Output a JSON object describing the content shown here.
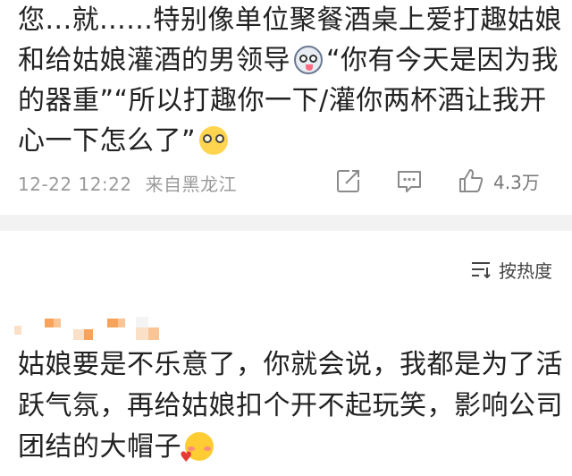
{
  "post": {
    "text_lines": [
      "您...就......特别像单位聚餐酒桌上爱打趣姑娘",
      "和给姑娘灌酒的男领导",
      "“你有今天是因为我",
      "的器重”“所以打趣你一下/灌你两杯酒让我开",
      "心一下怎么了”"
    ],
    "emoji_1": "doge-emoji",
    "emoji_2": "glasses-emoji",
    "meta": {
      "time": "12-22 12:22",
      "location": "来自黑龙江"
    },
    "actions": {
      "share_icon": "share-icon",
      "comment_icon": "comment-icon",
      "like_icon": "thumbs-up-icon",
      "like_count": "4.3万"
    }
  },
  "sort": {
    "icon": "sort-icon",
    "label": "按热度"
  },
  "reply": {
    "username": "",
    "text_lines": [
      "姑娘要是不乐意了，你就会说，我都是为了活",
      "跃气氛，再给姑娘扣个开不起玩笑，影响公司",
      "团结的大帽子"
    ],
    "emoji": "shy-heart-emoji"
  },
  "colors": {
    "text": "#222222",
    "meta": "#9a9a9a",
    "divider": "#f2f2f2",
    "mosaic": [
      "#f7a35c",
      "#f9c597",
      "#fbe0c8",
      "#f4f4f4"
    ]
  }
}
